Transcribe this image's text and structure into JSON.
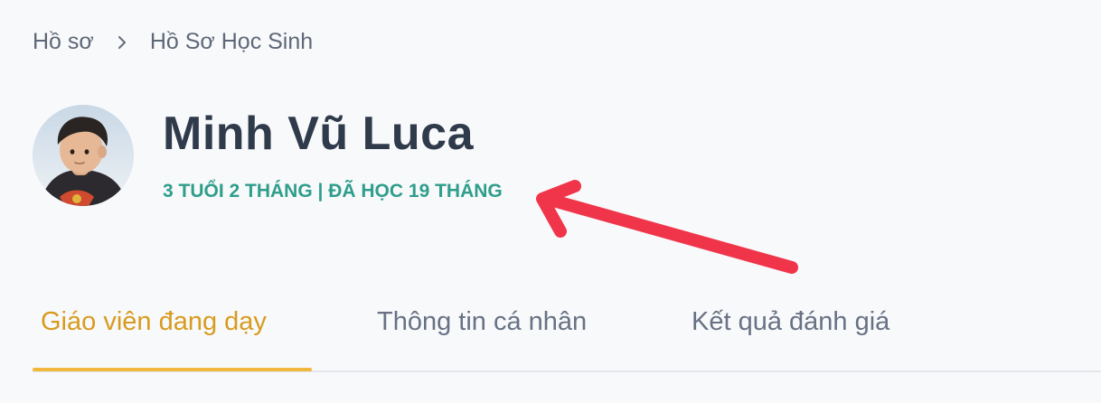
{
  "breadcrumb": {
    "items": [
      {
        "label": "Hồ sơ"
      },
      {
        "label": "Hồ Sơ Học Sinh"
      }
    ],
    "separator_icon": "chevron-right-icon"
  },
  "profile": {
    "name": "Minh Vũ Luca",
    "subtitle": "3 TUỔI 2 THÁNG | ĐÃ HỌC 19 THÁNG",
    "avatar_icon": "child-avatar-photo"
  },
  "tabs": [
    {
      "label": "Giáo viên đang dạy",
      "active": true
    },
    {
      "label": "Thông tin cá nhân",
      "active": false
    },
    {
      "label": "Kết quả đánh giá",
      "active": false
    }
  ],
  "colors": {
    "accent": "#d89b1f",
    "underline": "#f0b83c",
    "subtitle": "#2e9e8b",
    "title": "#2f3a4b",
    "annotation": "#f0354a"
  }
}
